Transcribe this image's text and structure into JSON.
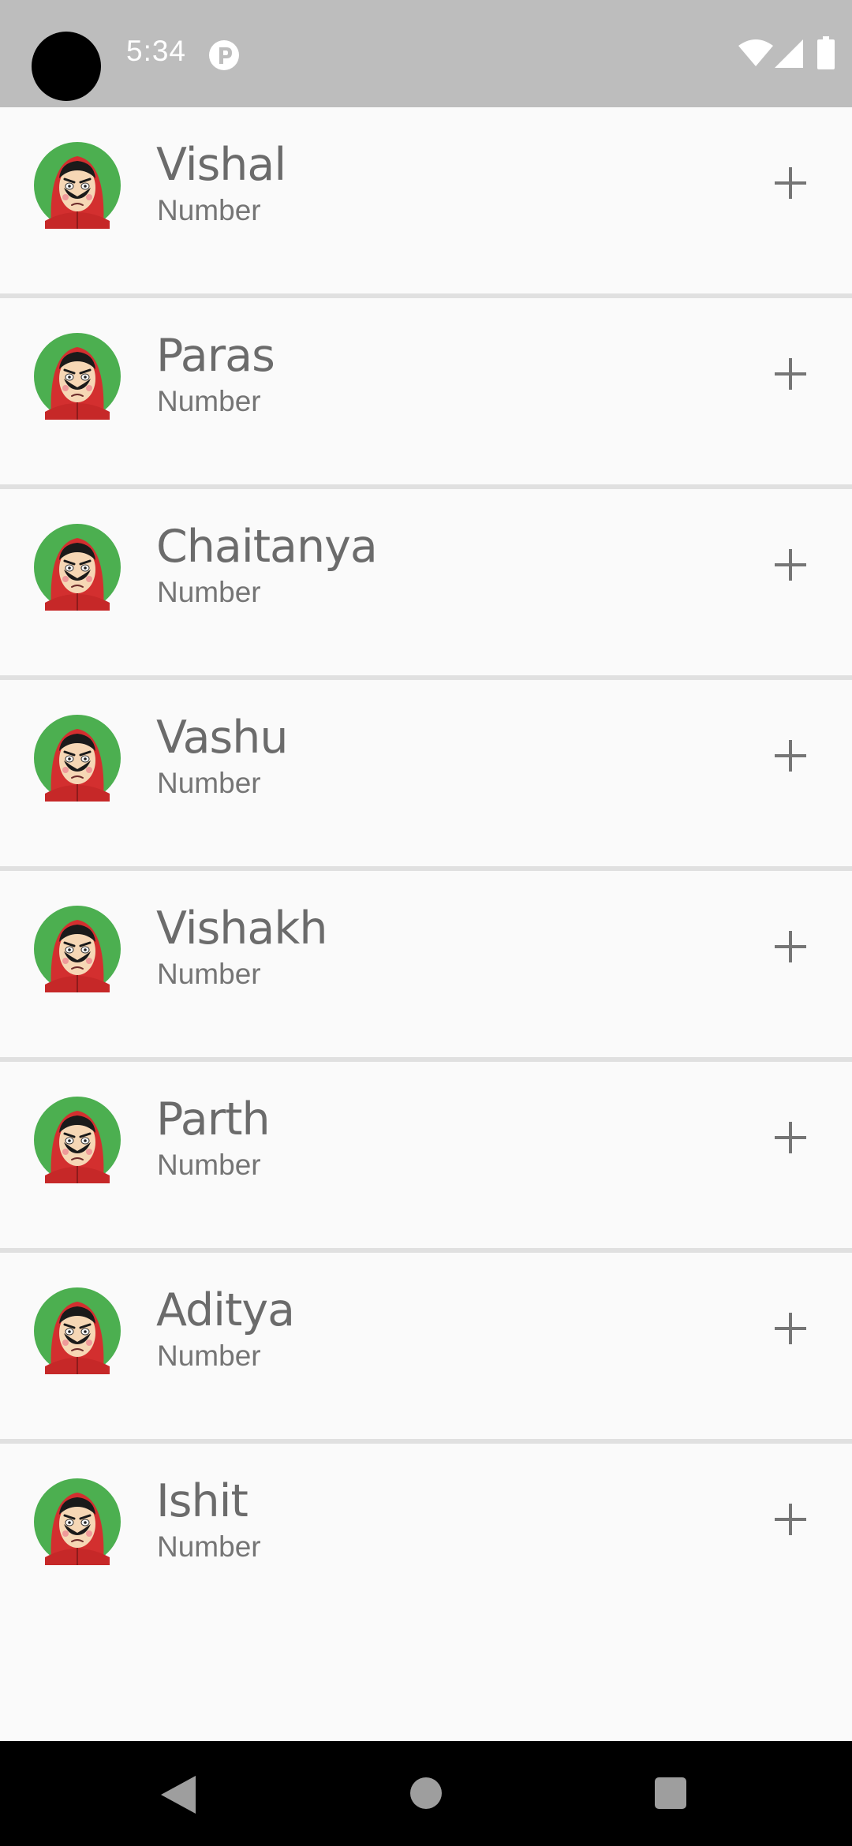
{
  "status_bar": {
    "time": "5:34",
    "icons": [
      "notification-p-icon",
      "wifi-icon",
      "signal-icon",
      "battery-icon"
    ]
  },
  "contacts": [
    {
      "name": "Vishal",
      "number": "Number"
    },
    {
      "name": "Paras",
      "number": "Number"
    },
    {
      "name": "Chaitanya",
      "number": "Number"
    },
    {
      "name": "Vashu",
      "number": "Number"
    },
    {
      "name": "Vishakh",
      "number": "Number"
    },
    {
      "name": "Parth",
      "number": "Number"
    },
    {
      "name": "Aditya",
      "number": "Number"
    },
    {
      "name": "Ishit",
      "number": "Number"
    }
  ],
  "row_action_icon": "plus-icon",
  "avatar_icon": "mask-avatar-icon",
  "nav_bar": {
    "icons": [
      "back-icon",
      "home-icon",
      "recents-icon"
    ]
  },
  "colors": {
    "status_bar": "#bdbdbd",
    "background": "#fafafa",
    "divider": "#e0e0e0",
    "avatar_bg": "#4caf50",
    "hood_red": "#d32f2f"
  }
}
